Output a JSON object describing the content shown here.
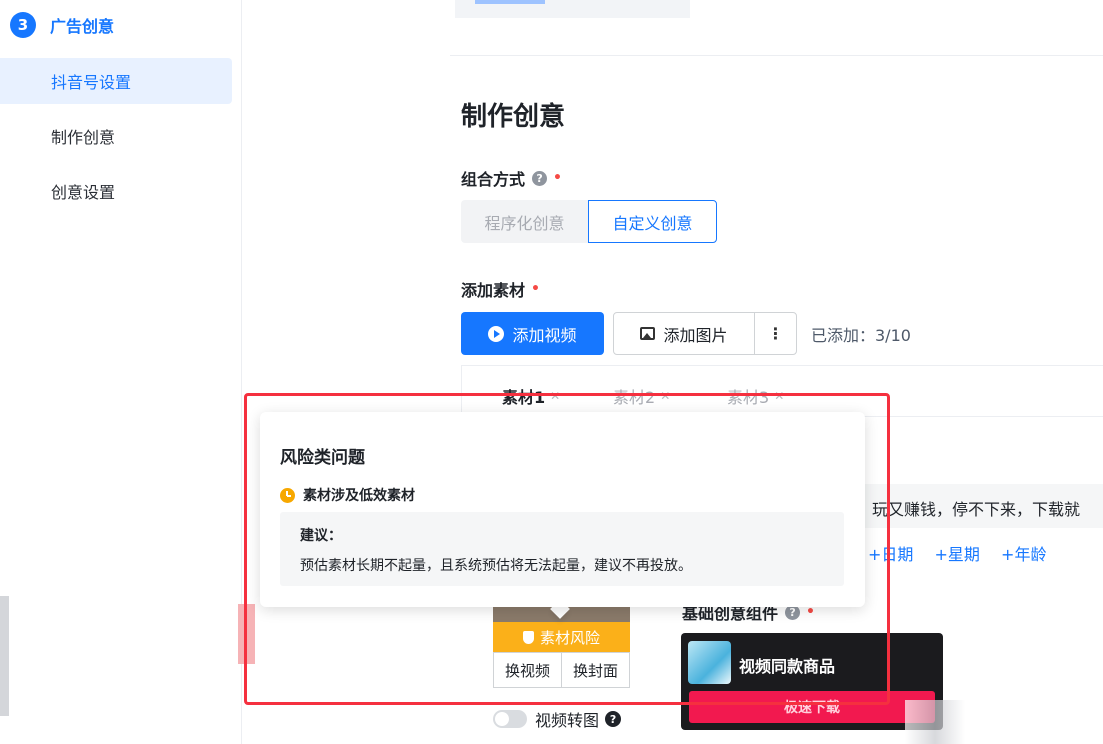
{
  "sidebar": {
    "step_number": "3",
    "step_label": "广告创意",
    "items": [
      {
        "label": "抖音号设置"
      },
      {
        "label": "制作创意"
      },
      {
        "label": "创意设置"
      }
    ]
  },
  "main": {
    "title": "制作创意",
    "combo": {
      "label": "组合方式",
      "options": [
        "程序化创意",
        "自定义创意"
      ],
      "selected": "自定义创意"
    },
    "material": {
      "label": "添加素材",
      "add_video": "添加视频",
      "add_image": "添加图片",
      "more": "⋮",
      "added_count": "已添加：3/10",
      "tabs": [
        "素材1",
        "素材2",
        "素材3"
      ]
    },
    "ad_text_snippet": "玩又赚钱，停不下来，下载就",
    "tags": [
      "+日期",
      "+星期",
      "+年龄"
    ],
    "thumb": {
      "risk_label": "素材风险",
      "replace_video": "换视频",
      "replace_cover": "换封面"
    },
    "basic_component": {
      "label": "基础创意组件",
      "product_name": "视频同款商品",
      "button": "极速下载"
    },
    "video_to_image": {
      "label": "视频转图"
    }
  },
  "popover": {
    "title": "风险类问题",
    "warning": "素材涉及低效素材",
    "suggestion_label": "建议：",
    "suggestion_text": "预估素材长期不起量，且系统预估将无法起量，建议不再投放。"
  },
  "colors": {
    "accent": "#1677ff",
    "warning": "#fbb019",
    "highlight": "#f5303f",
    "required": "#f54a45"
  },
  "icons": {
    "help": "?"
  }
}
